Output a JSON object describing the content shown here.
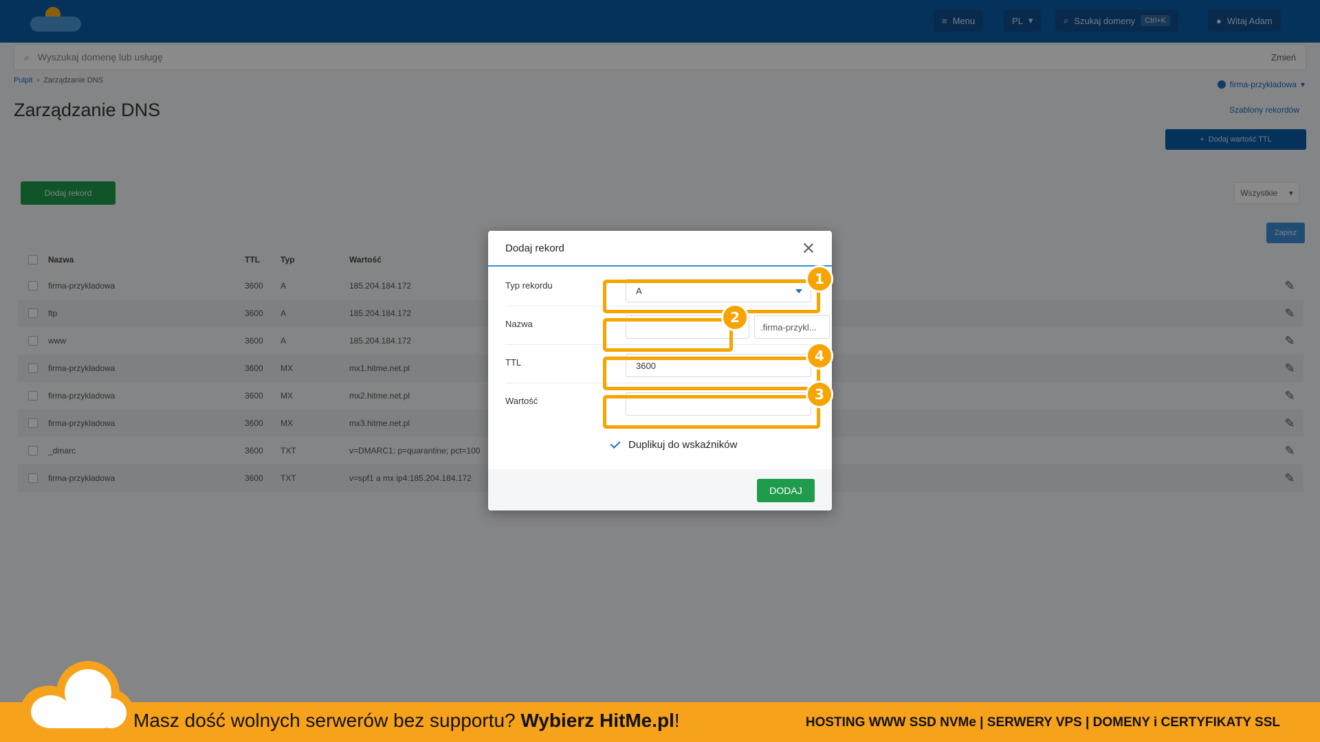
{
  "topbar": {
    "menu_label": "Menu",
    "lang_label": "PL",
    "search_label": "Szukaj domeny",
    "search_shortcut": "Ctrl+K",
    "user_label": "Witaj Adam"
  },
  "search": {
    "placeholder": "Wyszukaj domenę lub usługę",
    "lang": "Zmień"
  },
  "breadcrumb": {
    "home": "Pulpit",
    "current": "Zarządzanie DNS"
  },
  "page": {
    "title": "Zarządzanie DNS",
    "company_selector": "firma-przykladowa",
    "quick_link": "Szablony rekordów",
    "top_action": "Dodaj wartość TTL",
    "add_record_button": "Dodaj rekord",
    "filter_label": "Wszystkie",
    "save_button": "Zapisz"
  },
  "table": {
    "headers": [
      "Nazwa",
      "TTL",
      "Typ",
      "Wartość"
    ],
    "rows": [
      {
        "name": "firma-przykladowa",
        "ttl": "3600",
        "type": "A",
        "value": "185.204.184.172"
      },
      {
        "name": "ftp",
        "ttl": "3600",
        "type": "A",
        "value": "185.204.184.172"
      },
      {
        "name": "www",
        "ttl": "3600",
        "type": "A",
        "value": "185.204.184.172"
      },
      {
        "name": "firma-przykladowa",
        "ttl": "3600",
        "type": "MX",
        "value": "mx1.hitme.net.pl"
      },
      {
        "name": "firma-przykladowa",
        "ttl": "3600",
        "type": "MX",
        "value": "mx2.hitme.net.pl"
      },
      {
        "name": "firma-przykladowa",
        "ttl": "3600",
        "type": "MX",
        "value": "mx3.hitme.net.pl"
      },
      {
        "name": "_dmarc",
        "ttl": "3600",
        "type": "TXT",
        "value": "v=DMARC1; p=quarantine; pct=100"
      },
      {
        "name": "firma-przykladowa",
        "ttl": "3600",
        "type": "TXT",
        "value": "v=spf1 a mx ip4:185.204.184.172"
      }
    ]
  },
  "modal": {
    "title": "Dodaj rekord",
    "type_label": "Typ rekordu",
    "type_value": "A",
    "name_label": "Nazwa",
    "name_value": "",
    "name_suffix": ".firma-przykl...",
    "ttl_label": "TTL",
    "ttl_value": "3600",
    "value_label": "Wartość",
    "value_value": "",
    "duplicate_label": "Duplikuj do wskaźników",
    "submit": "DODAJ"
  },
  "callouts": [
    "1",
    "2",
    "4",
    "3"
  ],
  "ad": {
    "text_regular": "Masz dość wolnych serwerów bez supportu? ",
    "text_bold": "Wybierz HitMe.pl",
    "text_end": "!",
    "right": "HOSTING WWW SSD NVMe | SERWERY VPS | DOMENY i CERTYFIKATY SSL"
  },
  "colors": {
    "accent": "#f7a400",
    "brand_blue": "#0a5da8",
    "green": "#1f9b4c"
  }
}
